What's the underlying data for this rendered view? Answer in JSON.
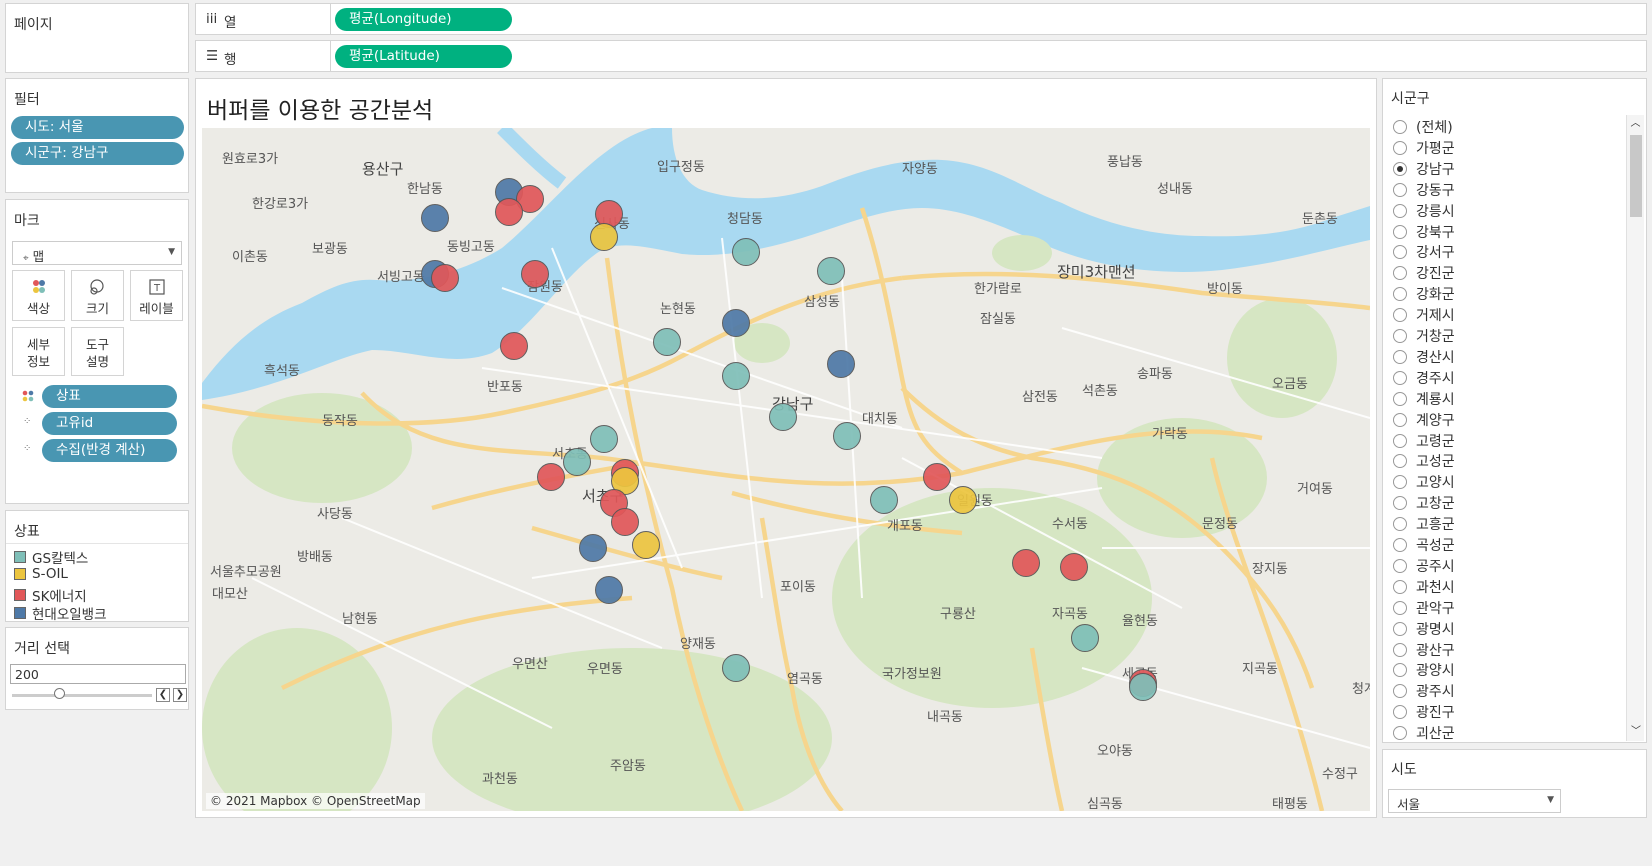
{
  "colors": {
    "gs": "#7fbfb8",
    "soil": "#ecc53f",
    "sk": "#e15759",
    "hyundai": "#4e79a7"
  },
  "pages_panel": {
    "title": "페이지"
  },
  "shelves": {
    "columns": {
      "icon": "iii",
      "label": "열",
      "pill": "평균(Longitude)"
    },
    "rows": {
      "icon": "☰",
      "label": "행",
      "pill": "평균(Latitude)"
    }
  },
  "filters": {
    "title": "필터",
    "items": [
      "시도: 서울",
      "시군구: 강남구"
    ]
  },
  "marks": {
    "title": "마크",
    "type": "맵",
    "buttons": {
      "color": "색상",
      "size": "크기",
      "label": "레이블",
      "detail": "세부\n정보",
      "tooltip": "도구\n설명"
    },
    "fields": [
      "상표",
      "고유id",
      "수집(반경 계산)"
    ]
  },
  "legend": {
    "title": "상표",
    "items": [
      {
        "label": "GS칼텍스",
        "color": "#7fbfb8"
      },
      {
        "label": "S-OIL",
        "color": "#ecc53f"
      },
      {
        "label": "SK에너지",
        "color": "#e15759"
      },
      {
        "label": "현대오일뱅크",
        "color": "#4e79a7"
      }
    ]
  },
  "distance": {
    "title": "거리 선택",
    "value": "200"
  },
  "viz": {
    "title": "버퍼를 이용한 공간분석",
    "attribution": "© 2021 Mapbox © OpenStreetMap"
  },
  "map_labels": [
    "원효로3가",
    "용산구",
    "한강로3가",
    "이촌동",
    "서빙고동",
    "보광동",
    "한남동",
    "동빙고동",
    "신사동",
    "잠원동",
    "논현동",
    "입구정동",
    "청담동",
    "삼성동",
    "자양동",
    "풍납동",
    "성내동",
    "둔촌동",
    "잠실동",
    "송파동",
    "오금동",
    "방이동",
    "거여동",
    "문정동",
    "가락동",
    "장지동",
    "강남구",
    "대치동",
    "개포동",
    "일원동",
    "수서동",
    "자곡동",
    "율현동",
    "세곡동",
    "포이동",
    "양재동",
    "서초동",
    "서초구",
    "방배동",
    "사당동",
    "남현동",
    "우면동",
    "염곡동",
    "내곡동",
    "주암동",
    "과천동",
    "흑석동",
    "동작동",
    "반포동",
    "삼전동",
    "석촌동",
    "한가람로",
    "장미3차맨션",
    "오야동",
    "심곡동",
    "태평동",
    "수정구",
    "구룡산",
    "우면산",
    "국가정보원",
    "서울추모공원",
    "대모산",
    "지곡동",
    "청계산"
  ],
  "sigungu": {
    "title": "시군구",
    "options": [
      "(전체)",
      "가평군",
      "강남구",
      "강동구",
      "강릉시",
      "강북구",
      "강서구",
      "강진군",
      "강화군",
      "거제시",
      "거창군",
      "경산시",
      "경주시",
      "계룡시",
      "계양구",
      "고령군",
      "고성군",
      "고양시",
      "고창군",
      "고흥군",
      "곡성군",
      "공주시",
      "과천시",
      "관악구",
      "광명시",
      "광산구",
      "광양시",
      "광주시",
      "광진구",
      "괴산군"
    ],
    "selected": "강남구"
  },
  "sido": {
    "title": "시도",
    "value": "서울"
  },
  "stations": [
    {
      "brand": "hyundai",
      "lon": 127.0175,
      "lat": 37.524
    },
    {
      "brand": "hyundai",
      "lon": 127.0245,
      "lat": 37.5275
    },
    {
      "brand": "sk",
      "lon": 127.0265,
      "lat": 37.5265
    },
    {
      "brand": "sk",
      "lon": 127.0245,
      "lat": 37.5248
    },
    {
      "brand": "sk",
      "lon": 127.034,
      "lat": 37.5245
    },
    {
      "brand": "soil",
      "lon": 127.0335,
      "lat": 37.5215
    },
    {
      "brand": "hyundai",
      "lon": 127.0175,
      "lat": 37.5165
    },
    {
      "brand": "sk",
      "lon": 127.0185,
      "lat": 37.516
    },
    {
      "brand": "sk",
      "lon": 127.027,
      "lat": 37.5165
    },
    {
      "brand": "gs",
      "lon": 127.047,
      "lat": 37.5195
    },
    {
      "brand": "gs",
      "lon": 127.055,
      "lat": 37.517
    },
    {
      "brand": "hyundai",
      "lon": 127.046,
      "lat": 37.51
    },
    {
      "brand": "gs",
      "lon": 127.0395,
      "lat": 37.5075
    },
    {
      "brand": "sk",
      "lon": 127.025,
      "lat": 37.507
    },
    {
      "brand": "gs",
      "lon": 127.046,
      "lat": 37.503
    },
    {
      "brand": "hyundai",
      "lon": 127.056,
      "lat": 37.5045
    },
    {
      "brand": "gs",
      "lon": 127.0505,
      "lat": 37.4975
    },
    {
      "brand": "gs",
      "lon": 127.0565,
      "lat": 37.495
    },
    {
      "brand": "gs",
      "lon": 127.0335,
      "lat": 37.4945
    },
    {
      "brand": "gs",
      "lon": 127.031,
      "lat": 37.4915
    },
    {
      "brand": "sk",
      "lon": 127.0285,
      "lat": 37.4895
    },
    {
      "brand": "sk",
      "lon": 127.0355,
      "lat": 37.49
    },
    {
      "brand": "soil",
      "lon": 127.0355,
      "lat": 37.489
    },
    {
      "brand": "sk",
      "lon": 127.0345,
      "lat": 37.486
    },
    {
      "brand": "sk",
      "lon": 127.0355,
      "lat": 37.4835
    },
    {
      "brand": "hyundai",
      "lon": 127.0325,
      "lat": 37.48
    },
    {
      "brand": "soil",
      "lon": 127.0375,
      "lat": 37.4805
    },
    {
      "brand": "hyundai",
      "lon": 127.034,
      "lat": 37.4745
    },
    {
      "brand": "gs",
      "lon": 127.06,
      "lat": 37.4865
    },
    {
      "brand": "sk",
      "lon": 127.065,
      "lat": 37.4895
    },
    {
      "brand": "soil",
      "lon": 127.0675,
      "lat": 37.4865
    },
    {
      "brand": "sk",
      "lon": 127.0735,
      "lat": 37.478
    },
    {
      "brand": "sk",
      "lon": 127.078,
      "lat": 37.4775
    },
    {
      "brand": "gs",
      "lon": 127.046,
      "lat": 37.464
    },
    {
      "brand": "gs",
      "lon": 127.079,
      "lat": 37.468
    },
    {
      "brand": "sk",
      "lon": 127.0845,
      "lat": 37.462
    },
    {
      "brand": "gs",
      "lon": 127.0845,
      "lat": 37.4615
    }
  ]
}
